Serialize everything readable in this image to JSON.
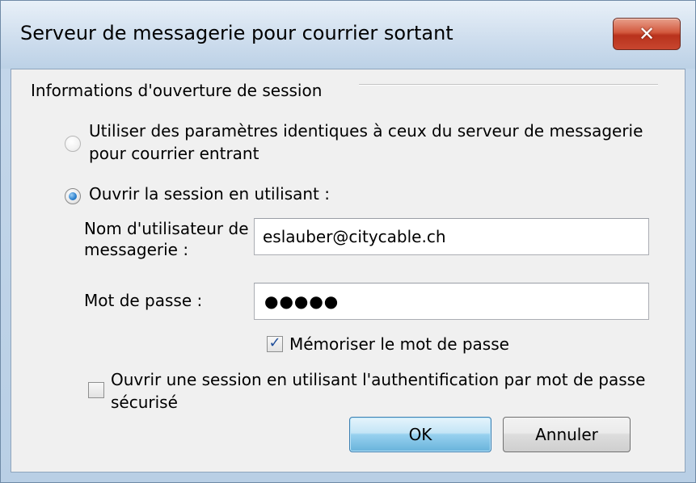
{
  "window": {
    "title": "Serveur de messagerie pour courrier sortant",
    "close_icon": "close-icon"
  },
  "group": {
    "label": "Informations d'ouverture de session"
  },
  "options": {
    "same_settings_label": "Utiliser des paramètres identiques à ceux du serveur de messagerie pour courrier entrant",
    "same_settings_selected": false,
    "logon_using_label": "Ouvrir la session en utilisant :",
    "logon_using_selected": true
  },
  "fields": {
    "username_label": "Nom d'utilisateur de messagerie :",
    "username_value": "eslauber@citycable.ch",
    "password_label": "Mot de passe :",
    "password_mask": "●●●●●"
  },
  "checkboxes": {
    "remember_label": "Mémoriser le mot de passe",
    "remember_checked": true,
    "secure_auth_label": "Ouvrir une session en utilisant l'authentification par mot de passe sécurisé",
    "secure_auth_checked": false
  },
  "buttons": {
    "ok": "OK",
    "cancel": "Annuler"
  },
  "colors": {
    "ok_border": "#3c7fb1",
    "close_button": "#c8462f"
  }
}
